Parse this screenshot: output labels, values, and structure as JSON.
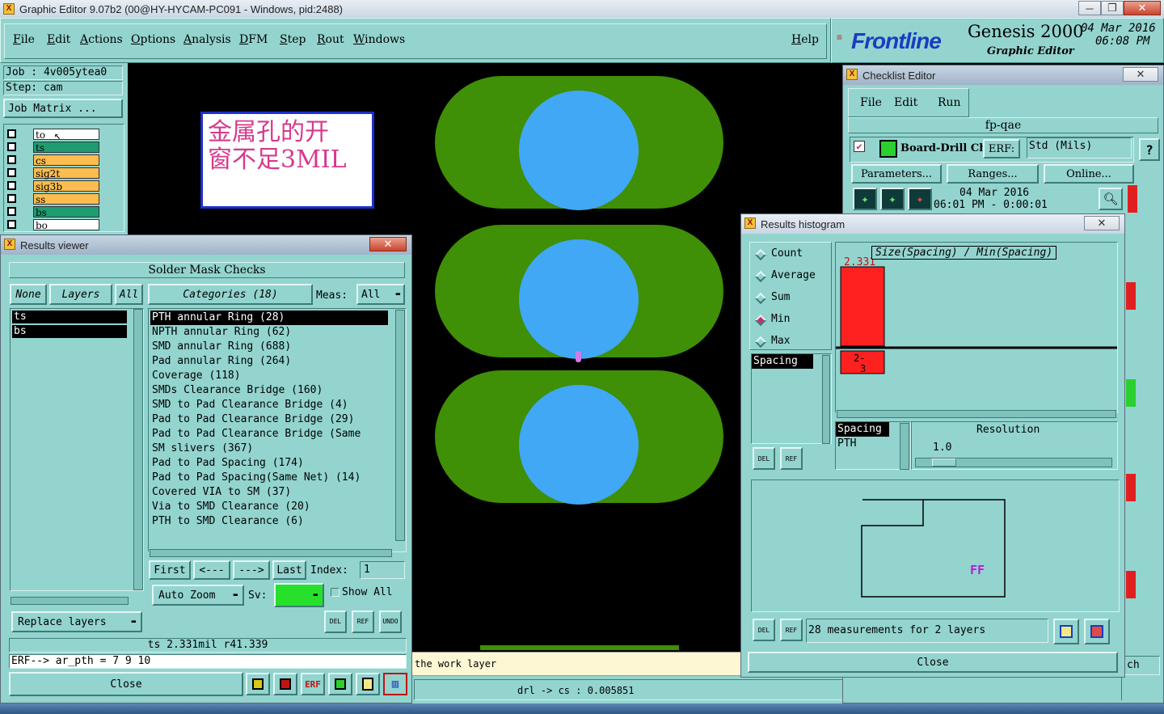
{
  "app": {
    "title": "Graphic Editor 9.07b2 (00@HY-HYCAM-PC091 - Windows, pid:2488)"
  },
  "menubar": {
    "items": [
      "File",
      "Edit",
      "Actions",
      "Options",
      "Analysis",
      "DFM",
      "Step",
      "Rout",
      "Windows"
    ],
    "help": "Help"
  },
  "brand": {
    "logo": "Frontline",
    "product": "Genesis 2000",
    "subtitle": "Graphic Editor",
    "date": "04 Mar 2016",
    "time": "06:08 PM"
  },
  "job": {
    "job_label": "Job : 4v005ytea0",
    "step_label": "Step: cam",
    "matrix_button": "Job Matrix ..."
  },
  "layers": [
    {
      "name": "to",
      "color": "#ffffff"
    },
    {
      "name": "ts",
      "color": "#1f9c72"
    },
    {
      "name": "cs",
      "color": "#fcbd4f"
    },
    {
      "name": "sig2t",
      "color": "#fcbd4f"
    },
    {
      "name": "sig3b",
      "color": "#fcbd4f"
    },
    {
      "name": "ss",
      "color": "#fcbd4f"
    },
    {
      "name": "bs",
      "color": "#1f9c72"
    },
    {
      "name": "bo",
      "color": "#ffffff"
    }
  ],
  "note": {
    "line1": "金属孔的开",
    "line2": "窗不足3MIL"
  },
  "canvas": {
    "pad_color": "#3f8f07",
    "hole_color": "#40a8f5",
    "marker_color": "#d27ae8"
  },
  "results_viewer": {
    "title": "Results viewer",
    "header": "Solder Mask Checks",
    "none_btn": "None",
    "layers_btn": "Layers",
    "all_btn": "All",
    "categories_btn": "Categories (18)",
    "meas_label": "Meas:",
    "meas_value": "All",
    "layer_list": [
      "ts",
      "bs"
    ],
    "categories": [
      "PTH annular Ring (28)",
      "NPTH annular Ring (62)",
      "SMD annular Ring (688)",
      "Pad annular Ring (264)",
      "Coverage (118)",
      "SMDs Clearance Bridge (160)",
      "SMD to Pad Clearance Bridge (4)",
      "Pad to Pad Clearance Bridge (29)",
      "Pad to Pad Clearance Bridge (Same",
      "SM slivers (367)",
      "Pad to Pad Spacing (174)",
      "Pad to Pad Spacing(Same Net) (14)",
      "Covered VIA to SM (37)",
      "Via to SMD Clearance (20)",
      "PTH to SMD Clearance (6)"
    ],
    "nav": {
      "first": "First",
      "prev": "<---",
      "next": "--->",
      "last": "Last",
      "index_label": "Index:",
      "index_value": "1"
    },
    "auto_zoom": "Auto Zoom",
    "sv_label": "Sv:",
    "show_all": "Show All",
    "replace_layers": "Replace layers",
    "icons": {
      "del": "DEL",
      "ref": "REF",
      "undo": "UNDO"
    },
    "status1": "ts 2.331mil  r41.339",
    "status2": "ERF--> ar_pth = 7 9 10",
    "close": "Close"
  },
  "work_layer_msg": "the work layer",
  "status_bottom": "drl -> cs : 0.005851",
  "checklist": {
    "title": "Checklist Editor",
    "menu": [
      "File",
      "Edit",
      "Run"
    ],
    "name": "fp-qae",
    "item": "Board-Drill Che",
    "erf_label": "ERF:",
    "erf_value": "Std (Mils)",
    "help": "?",
    "params": "Parameters...",
    "ranges": "Ranges...",
    "online": "Online...",
    "date": "04 Mar 2016",
    "time": "06:01 PM - 0:00:01",
    "bottom_frag": "ch"
  },
  "histogram": {
    "title": "Results histogram",
    "options": [
      "Count",
      "Average",
      "Sum",
      "Min",
      "Max"
    ],
    "selected": "Min",
    "chart_title": "Size(Spacing) / Min(Spacing)",
    "bar_value": "2.331",
    "bar_label_1": "2-",
    "bar_label_2": "3",
    "list_item": "Spacing",
    "list2_item1": "Spacing",
    "list2_item2": "PTH",
    "resolution_label": "Resolution",
    "resolution_value": "1.0",
    "icons": {
      "del": "DEL",
      "ref": "REF"
    },
    "measurements": "28 measurements for 2 layers",
    "preview_label": "FF",
    "close": "Close"
  },
  "chart_data": {
    "type": "bar",
    "title": "Size(Spacing) / Min(Spacing)",
    "categories": [
      "2-3"
    ],
    "values": [
      2.331
    ],
    "color": "#ff2020"
  }
}
